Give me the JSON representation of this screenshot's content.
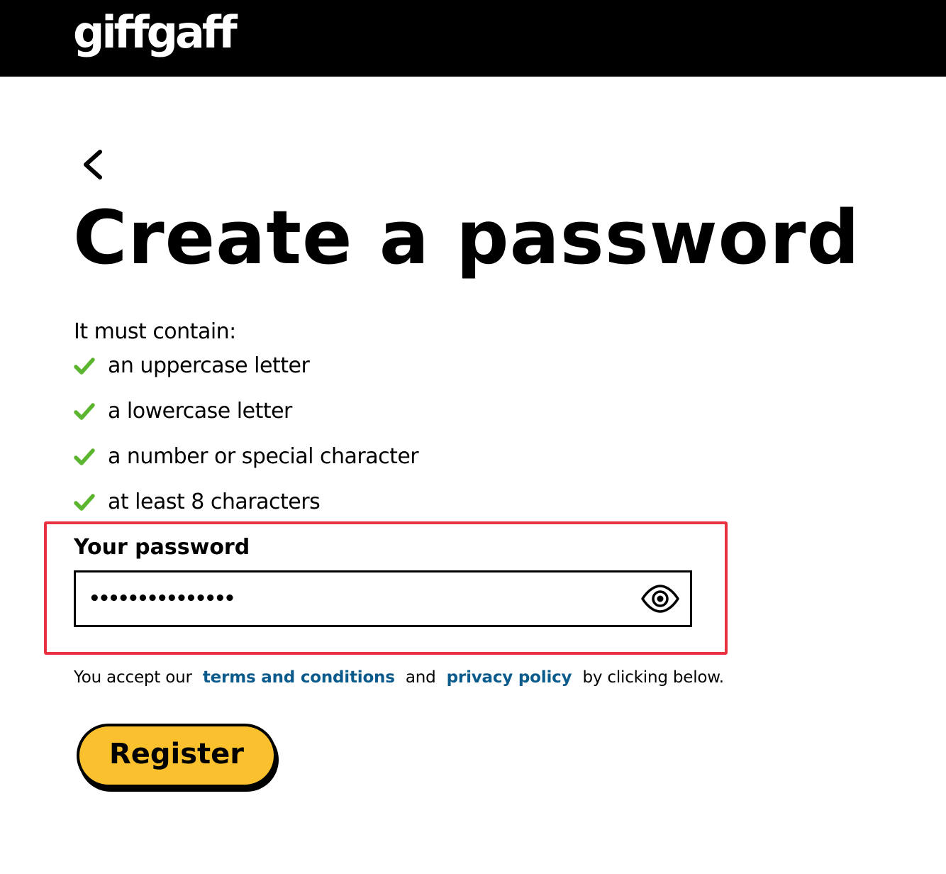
{
  "header": {
    "logo_text": "giffgaff"
  },
  "nav": {
    "back_icon": "chevron-left-icon"
  },
  "page": {
    "title": "Create a password",
    "requirements_intro": "It must contain:",
    "requirements": [
      {
        "label": "an uppercase letter",
        "met": true
      },
      {
        "label": "a lowercase letter",
        "met": true
      },
      {
        "label": "a number or special character",
        "met": true
      },
      {
        "label": "at least 8 characters",
        "met": true
      }
    ]
  },
  "password": {
    "label": "Your password",
    "masked_value": "•••••••••••••••",
    "toggle_icon": "eye-icon"
  },
  "legal": {
    "prefix": "You accept our",
    "terms_link": "terms and conditions",
    "conjunction": "and",
    "privacy_link": "privacy policy",
    "suffix": "by clicking below."
  },
  "actions": {
    "register_label": "Register"
  },
  "colors": {
    "header_bg": "#000000",
    "check_green": "#5bb52e",
    "link_blue": "#0a5b8c",
    "button_yellow": "#fbc02d",
    "highlight_red": "#e8323f"
  }
}
